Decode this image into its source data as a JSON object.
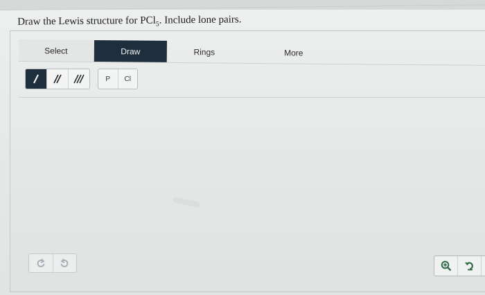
{
  "question": {
    "prefix": "Draw the Lewis structure for PCl",
    "subscript": "5",
    "suffix": ". Include lone pairs."
  },
  "tabs": [
    {
      "label": "Select"
    },
    {
      "label": "Draw"
    },
    {
      "label": "Rings"
    },
    {
      "label": "More"
    }
  ],
  "toolbar": {
    "bonds": [
      {
        "icon": "single-bond-icon"
      },
      {
        "icon": "double-bond-icon"
      },
      {
        "icon": "triple-bond-icon"
      }
    ],
    "atoms": [
      {
        "label": "P"
      },
      {
        "label": "Cl"
      }
    ]
  },
  "bottom_controls": {
    "undo_icon": "undo-icon",
    "redo_icon": "redo-icon",
    "zoom_in_icon": "zoom-in-icon",
    "reset_icon": "reset-icon"
  },
  "colors": {
    "active_tab": "#1f2e3d",
    "accent_green": "#3b7d4f"
  }
}
